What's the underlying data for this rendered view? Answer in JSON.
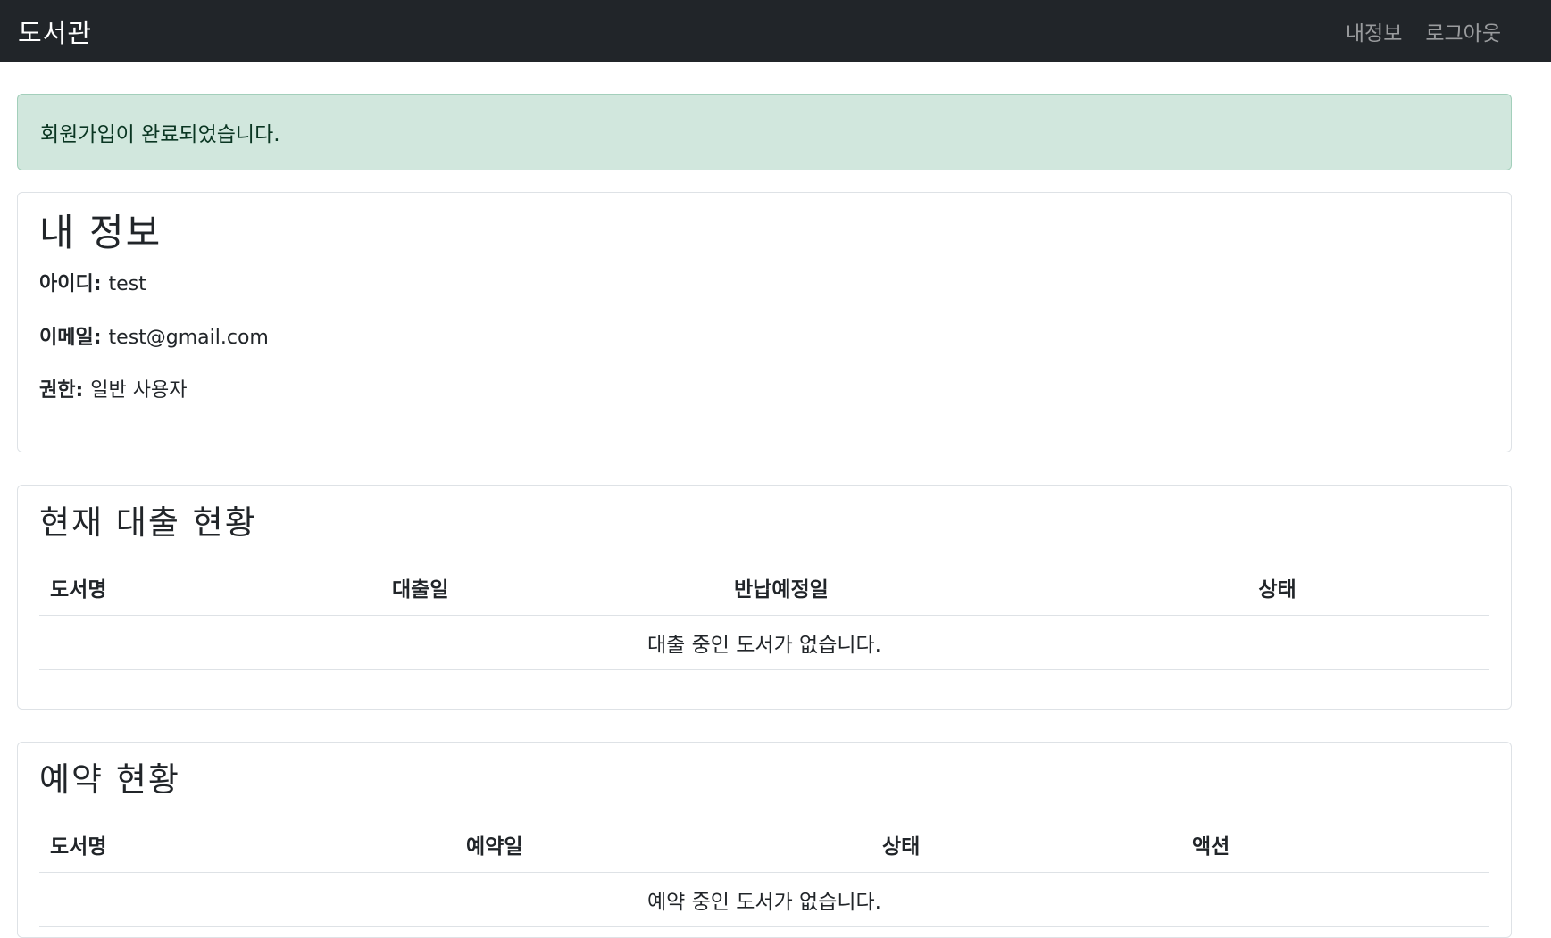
{
  "navbar": {
    "brand": "도서관",
    "links": [
      "내정보",
      "로그아웃"
    ]
  },
  "alert": {
    "message": "회원가입이 완료되었습니다."
  },
  "profile": {
    "title": "내 정보",
    "id_label": "아이디:",
    "id_value": "test",
    "email_label": "이메일:",
    "email_value": "test@gmail.com",
    "role_label": "권한:",
    "role_value": "일반 사용자"
  },
  "loans": {
    "title": "현재 대출 현황",
    "columns": [
      "도서명",
      "대출일",
      "반납예정일",
      "상태"
    ],
    "empty_message": "대출 중인 도서가 없습니다."
  },
  "reservations": {
    "title": "예약 현황",
    "columns": [
      "도서명",
      "예약일",
      "상태",
      "액션"
    ],
    "empty_message": "예약 중인 도서가 없습니다."
  },
  "colors": {
    "navbar_bg": "#212529",
    "alert_bg": "#d1e7dd",
    "alert_border": "#a3cfbb"
  }
}
